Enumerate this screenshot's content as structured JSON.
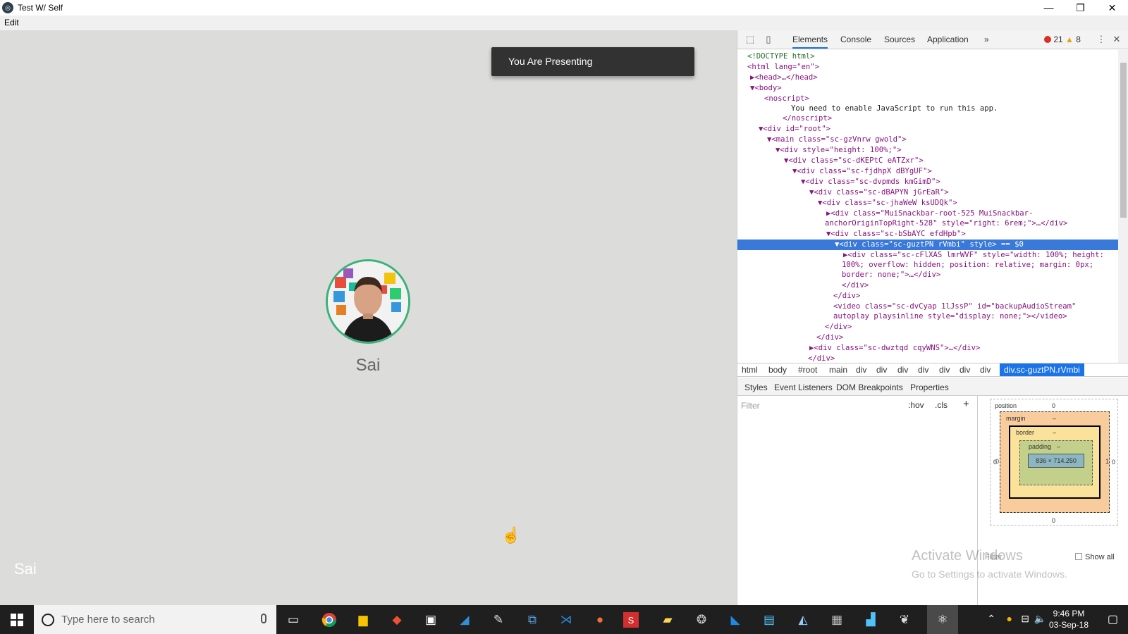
{
  "window": {
    "title": "Test W/ Self",
    "menu": [
      "Edit"
    ]
  },
  "stage": {
    "snackbar": "You Are Presenting",
    "avatar_name": "Sai",
    "corner_name": "Sai"
  },
  "devtools": {
    "tabs": [
      "Elements",
      "Console",
      "Sources",
      "Application"
    ],
    "error_count": "21",
    "warning_count": "8",
    "dom": [
      "<!DOCTYPE html>",
      "<html lang=\"en\">",
      "▶<head>…</head>",
      "▼<body>",
      "<noscript>",
      "You need to enable JavaScript to run this app.",
      "</noscript>",
      "▼<div id=\"root\">",
      "▼<main class=\"sc-gzVnrw gwold\">",
      "▼<div style=\"height: 100%;\">",
      "▼<div class=\"sc-dKEPtC eATZxr\">",
      "▼<div class=\"sc-fjdhpX dBYgUF\">",
      "▼<div class=\"sc-dvpmds kmGimD\">",
      "▼<div class=\"sc-dBAPYN jGrEaR\">",
      "▼<div class=\"sc-jhaWeW ksUDQk\">",
      "▶<div class=\"MuiSnackbar-root-525 MuiSnackbar-",
      "anchorOriginTopRight-528\" style=\"right: 6rem;\">…</div>",
      "▼<div class=\"sc-bSbAYC efdHpb\">",
      "▼<div class=\"sc-guztPN rVmbi\" style> == $0",
      "▶<div class=\"sc-cFlXAS lmrWVF\" style=\"width: 100%; height:",
      "100%; overflow: hidden; position: relative; margin: 0px;",
      "border: none;\">…</div>",
      "</div>",
      "</div>",
      "<video class=\"sc-dvCyap 1lJssP\" id=\"backupAudioStream\"",
      "autoplay playsinline style=\"display: none;\"></video>",
      "</div>",
      "</div>",
      "▶<div class=\"sc-dwztqd cqyWNS\">…</div>",
      "</div>"
    ],
    "breadcrumbs": [
      "html",
      "body",
      "#root",
      "main",
      "div",
      "div",
      "div",
      "div",
      "div",
      "div",
      "div"
    ],
    "breadcrumb_active": "div.sc-guztPN.rVmbi",
    "sub_tabs": [
      "Styles",
      "Event Listeners",
      "DOM Breakpoints",
      "Properties"
    ],
    "filter_placeholder": "Filter",
    "hov": ":hov",
    "cls": ".cls",
    "box_model": {
      "position_label": "position",
      "position_top": "0",
      "position_bottom": "0",
      "position_left": "0",
      "position_right": "0",
      "margin_label": "margin",
      "margin_value": "–",
      "border_label": "border",
      "border_value": "–",
      "padding_label": "padding",
      "padding_value": "–",
      "content": "836 × 714.250",
      "side_left": "0",
      "side_right": "1"
    },
    "computed_filter": "Filter",
    "show_all": "Show all"
  },
  "watermark": {
    "line1": "Activate Windows",
    "line2": "Go to Settings to activate Windows."
  },
  "taskbar": {
    "search_placeholder": "Type here to search",
    "time": "9:46 PM",
    "date": "03-Sep-18"
  }
}
